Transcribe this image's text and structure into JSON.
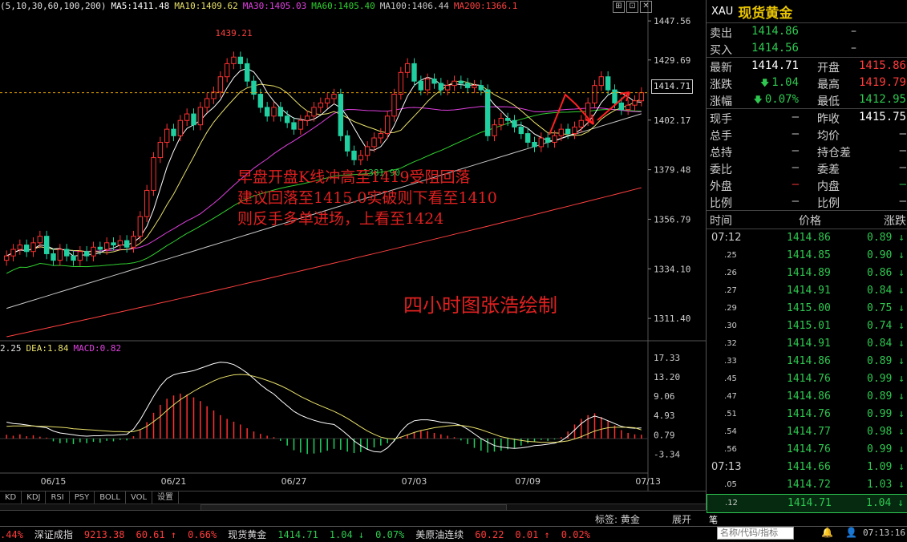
{
  "ma_legend": [
    {
      "text": "(5,10,30,60,100,200)",
      "color": "#e0e0e0"
    },
    {
      "text": "MA5:1411.48",
      "color": "#ffffff"
    },
    {
      "text": "MA10:1409.62",
      "color": "#e8e06a"
    },
    {
      "text": "MA30:1405.03",
      "color": "#e040e0"
    },
    {
      "text": "MA60:1405.40",
      "color": "#30d030"
    },
    {
      "text": "MA100:1406.44",
      "color": "#c8c8c8"
    },
    {
      "text": "MA200:1366.1",
      "color": "#ff4040"
    }
  ],
  "macd_legend": [
    {
      "text": "2.25",
      "color": "#e0e0e0"
    },
    {
      "text": "DEA:1.84",
      "color": "#e8e06a"
    },
    {
      "text": "MACD:0.82",
      "color": "#e040e0"
    }
  ],
  "price_tag": "1414.71",
  "annotation": {
    "lines": [
      "早盘开盘K线冲高至1419受阻回落",
      "建议回落至1415.0实破则下看至1410",
      "则反手多单进场，上看至1424"
    ],
    "credit": "四小时图张浩绘制"
  },
  "chart_data": {
    "type": "candlestick",
    "price_axis": [
      "1447.56",
      "1429.69",
      "1402.17",
      "1379.48",
      "1356.79",
      "1334.10",
      "1311.40"
    ],
    "price_axis_values": [
      1447.56,
      1429.69,
      1402.17,
      1379.48,
      1356.79,
      1334.1,
      1311.4
    ],
    "ylim": [
      1303,
      1452
    ],
    "macd_axis": [
      "17.33",
      "13.20",
      "9.06",
      "4.93",
      "0.79",
      "-3.34"
    ],
    "macd_axis_values": [
      17.33,
      13.2,
      9.06,
      4.93,
      0.79,
      -3.34
    ],
    "macd_ylim": [
      -6,
      19
    ],
    "x_labels": [
      {
        "label": "06/15",
        "index": 7
      },
      {
        "label": "06/21",
        "index": 25
      },
      {
        "label": "06/27",
        "index": 43
      },
      {
        "label": "07/03",
        "index": 61
      },
      {
        "label": "07/09",
        "index": 78
      },
      {
        "label": "07/13",
        "index": 96
      }
    ],
    "high_label": {
      "text": "1439.21",
      "index": 34,
      "value": 1439.21
    },
    "low_label": {
      "text": "1381.90",
      "index": 53,
      "value": 1381.9
    },
    "last_price": 1414.71,
    "closes": [
      1340,
      1343,
      1345,
      1342,
      1346,
      1349,
      1341,
      1338,
      1343,
      1340,
      1338,
      1342,
      1340,
      1344,
      1343,
      1346,
      1345,
      1347,
      1344,
      1349,
      1358,
      1370,
      1385,
      1392,
      1398,
      1395,
      1402,
      1405,
      1400,
      1408,
      1412,
      1415,
      1422,
      1428,
      1431,
      1428,
      1420,
      1414,
      1408,
      1404,
      1408,
      1404,
      1401,
      1398,
      1402,
      1404,
      1408,
      1410,
      1412,
      1414,
      1395,
      1388,
      1384,
      1386,
      1390,
      1394,
      1396,
      1404,
      1414,
      1424,
      1428,
      1420,
      1416,
      1421,
      1419,
      1416,
      1418,
      1420,
      1419,
      1417,
      1418,
      1416,
      1395,
      1400,
      1403,
      1402,
      1399,
      1396,
      1392,
      1390,
      1394,
      1392,
      1395,
      1398,
      1396,
      1399,
      1402,
      1410,
      1418,
      1422,
      1416,
      1410,
      1407,
      1409,
      1411,
      1414.71
    ],
    "volume_candles_note": "",
    "macd_hist": [
      0.8,
      0.6,
      0.9,
      0.5,
      0.7,
      0.4,
      0.2,
      -0.6,
      -1.0,
      -0.9,
      -1.2,
      -0.8,
      -1.0,
      -0.7,
      -0.9,
      -0.5,
      -0.6,
      -0.3,
      -0.4,
      0.5,
      1.8,
      3.5,
      5.5,
      7.2,
      8.5,
      9.2,
      9.6,
      9.4,
      8.8,
      8.0,
      6.9,
      6.0,
      5.0,
      4.2,
      3.6,
      3.0,
      2.2,
      1.5,
      1.0,
      0.6,
      0.3,
      -0.5,
      -1.5,
      -2.5,
      -3.0,
      -3.3,
      -3.2,
      -3.0,
      -2.6,
      -2.2,
      -2.4,
      -2.8,
      -3.1,
      -2.9,
      -2.4,
      -1.9,
      -1.5,
      -1.0,
      -0.6,
      0.4,
      0.9,
      1.4,
      1.8,
      1.6,
      1.2,
      0.9,
      0.6,
      0.3,
      -0.4,
      -1.2,
      -2.0,
      -2.6,
      -3.0,
      -2.8,
      -2.6,
      -2.3,
      -2.0,
      -1.5,
      -1.0,
      -0.6,
      -0.3,
      -0.5,
      -0.2,
      0.3,
      1.5,
      3.0,
      4.2,
      5.0,
      5.4,
      4.6,
      3.8,
      2.8,
      1.8,
      1.2,
      0.9,
      0.82
    ],
    "dif": [
      3.5,
      3.2,
      3.1,
      2.9,
      2.7,
      2.5,
      2.3,
      1.6,
      1.2,
      1.0,
      0.8,
      0.6,
      0.5,
      0.6,
      0.6,
      0.7,
      0.7,
      0.8,
      0.9,
      2.0,
      4.0,
      6.5,
      9.0,
      11.2,
      12.8,
      13.6,
      14.0,
      14.2,
      14.5,
      15.0,
      15.5,
      16.0,
      16.3,
      16.2,
      15.8,
      15.0,
      14.0,
      12.8,
      11.5,
      10.4,
      9.5,
      8.2,
      7.0,
      5.8,
      5.0,
      4.4,
      3.9,
      3.5,
      3.2,
      3.0,
      2.0,
      0.8,
      -0.5,
      -1.5,
      -2.3,
      -2.8,
      -2.9,
      -2.0,
      -0.5,
      1.5,
      3.0,
      3.8,
      4.0,
      4.0,
      3.8,
      3.5,
      3.4,
      3.2,
      2.8,
      2.0,
      1.0,
      0.0,
      -0.8,
      -1.5,
      -1.8,
      -2.0,
      -2.1,
      -2.0,
      -1.8,
      -1.5,
      -1.4,
      -1.2,
      -1.0,
      -0.5,
      0.5,
      1.8,
      3.2,
      4.2,
      4.8,
      4.4,
      3.8,
      3.2,
      2.6,
      2.3,
      2.2,
      2.25
    ],
    "dea": [
      2.6,
      2.7,
      2.7,
      2.7,
      2.7,
      2.6,
      2.6,
      2.5,
      2.4,
      2.3,
      2.1,
      2.0,
      1.9,
      1.8,
      1.7,
      1.6,
      1.5,
      1.5,
      1.4,
      1.5,
      1.9,
      2.6,
      3.6,
      4.7,
      6.0,
      7.2,
      8.3,
      9.2,
      10.1,
      10.9,
      11.6,
      12.3,
      12.9,
      13.3,
      13.6,
      13.7,
      13.6,
      13.3,
      12.9,
      12.4,
      11.9,
      11.3,
      10.6,
      9.8,
      9.0,
      8.3,
      7.6,
      7.0,
      6.4,
      5.8,
      5.1,
      4.3,
      3.4,
      2.5,
      1.6,
      0.9,
      0.3,
      0.0,
      -0.1,
      0.3,
      0.8,
      1.3,
      1.7,
      2.0,
      2.3,
      2.5,
      2.7,
      2.8,
      2.8,
      2.6,
      2.3,
      1.9,
      1.4,
      0.9,
      0.4,
      0.1,
      -0.2,
      -0.4,
      -0.6,
      -0.7,
      -0.8,
      -0.8,
      -0.8,
      -0.7,
      -0.5,
      -0.1,
      0.4,
      1.0,
      1.6,
      2.0,
      2.3,
      2.4,
      2.4,
      2.4,
      2.3,
      1.84
    ]
  },
  "tabs": [
    "KD",
    "KDJ",
    "RSI",
    "PSY",
    "BOLL",
    "VOL",
    "设置"
  ],
  "bottom": {
    "bookmark": "标签: 黄金",
    "expand": "展开",
    "note": "笔"
  },
  "panel": {
    "code": "XAU",
    "name": "现货黄金",
    "quote": {
      "sell_label": "卖出",
      "sell_value": "1414.86",
      "sell_extra": "–",
      "buy_label": "买入",
      "buy_value": "1414.56",
      "buy_extra": "–",
      "rows": [
        {
          "l1": "最新",
          "v1": "1414.71",
          "c1": "#ffffff",
          "l2": "开盘",
          "v2": "1415.86",
          "c2": "#ff3b3b"
        },
        {
          "l1": "涨跌",
          "v1": "1.04",
          "c1": "#2ec850",
          "arrow1": "🡇",
          "l2": "最高",
          "v2": "1419.79",
          "c2": "#ff3b3b"
        },
        {
          "l1": "涨幅",
          "v1": "0.07%",
          "c1": "#2ec850",
          "arrow1": "🡇",
          "l2": "最低",
          "v2": "1412.95",
          "c2": "#2ec850"
        },
        {
          "l1": "现手",
          "v1": "–",
          "c1": "#cccccc",
          "l2": "昨收",
          "v2": "1415.75",
          "c2": "#ffffff"
        },
        {
          "l1": "总手",
          "v1": "–",
          "c1": "#cccccc",
          "l2": "均价",
          "v2": "–",
          "c2": "#cccccc"
        },
        {
          "l1": "总持",
          "v1": "–",
          "c1": "#cccccc",
          "l2": "持仓差",
          "v2": "–",
          "c2": "#cccccc"
        },
        {
          "l1": "委比",
          "v1": "–",
          "c1": "#cccccc",
          "l2": "委差",
          "v2": "–",
          "c2": "#cccccc"
        },
        {
          "l1": "外盘",
          "v1": "–",
          "c1": "#ff3b3b",
          "l2": "内盘",
          "v2": "–",
          "c2": "#2ec850"
        },
        {
          "l1": "比例",
          "v1": "–",
          "c1": "#cccccc",
          "l2": "比例",
          "v2": "–",
          "c2": "#cccccc"
        }
      ]
    },
    "ticks_header": {
      "time": "时间",
      "price": "价格",
      "change": "涨跌"
    },
    "ticks": [
      {
        "time": "07:12",
        "sub": false,
        "price": "1414.86",
        "change": "0.89"
      },
      {
        "time": "25",
        "sub": true,
        "price": "1414.85",
        "change": "0.90"
      },
      {
        "time": "26",
        "sub": true,
        "price": "1414.89",
        "change": "0.86"
      },
      {
        "time": "27",
        "sub": true,
        "price": "1414.91",
        "change": "0.84"
      },
      {
        "time": "29",
        "sub": true,
        "price": "1415.00",
        "change": "0.75"
      },
      {
        "time": "30",
        "sub": true,
        "price": "1415.01",
        "change": "0.74"
      },
      {
        "time": "32",
        "sub": true,
        "price": "1414.91",
        "change": "0.84"
      },
      {
        "time": "33",
        "sub": true,
        "price": "1414.86",
        "change": "0.89"
      },
      {
        "time": "45",
        "sub": true,
        "price": "1414.76",
        "change": "0.99"
      },
      {
        "time": "47",
        "sub": true,
        "price": "1414.86",
        "change": "0.89"
      },
      {
        "time": "51",
        "sub": true,
        "price": "1414.76",
        "change": "0.99"
      },
      {
        "time": "54",
        "sub": true,
        "price": "1414.77",
        "change": "0.98"
      },
      {
        "time": "56",
        "sub": true,
        "price": "1414.76",
        "change": "0.99"
      },
      {
        "time": "07:13",
        "sub": false,
        "price": "1414.66",
        "change": "1.09"
      },
      {
        "time": "05",
        "sub": true,
        "price": "1414.72",
        "change": "1.03"
      },
      {
        "time": "12",
        "sub": true,
        "price": "1414.71",
        "change": "1.04"
      }
    ]
  },
  "ticker": [
    {
      "text": ".44%",
      "color": "#ff3b3b"
    },
    {
      "text": "深证成指",
      "color": "#dddddd"
    },
    {
      "text": "9213.38",
      "color": "#ff3b3b"
    },
    {
      "text": "60.61 ↑",
      "color": "#ff3b3b"
    },
    {
      "text": "0.66%",
      "color": "#ff3b3b"
    },
    {
      "text": "现货黄金",
      "color": "#dddddd"
    },
    {
      "text": "1414.71",
      "color": "#2ec850"
    },
    {
      "text": "1.04 ↓",
      "color": "#2ec850"
    },
    {
      "text": "0.07%",
      "color": "#2ec850"
    },
    {
      "text": "美原油连续",
      "color": "#dddddd"
    },
    {
      "text": "60.22",
      "color": "#ff3b3b"
    },
    {
      "text": "0.01 ↑",
      "color": "#ff3b3b"
    },
    {
      "text": "0.02%",
      "color": "#ff3b3b"
    }
  ],
  "search_placeholder": "名称/代码/指标",
  "clock": "07:13:16"
}
